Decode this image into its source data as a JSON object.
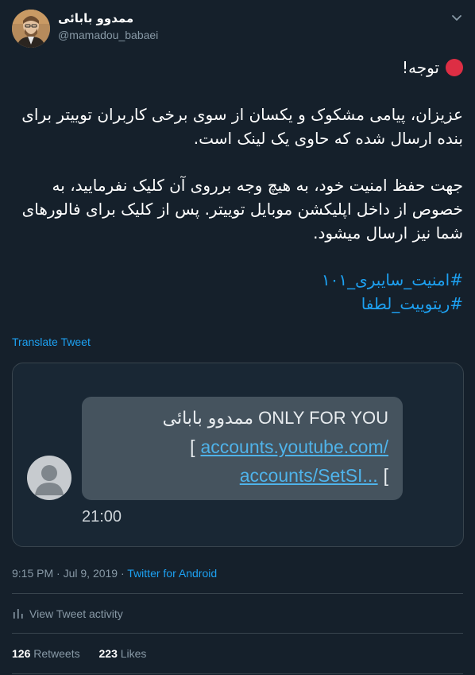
{
  "author": {
    "display_name": "ممدوو بابائی",
    "handle": "@mamadou_babaei"
  },
  "tweet": {
    "line_attention": "توجه!",
    "paragraph1": "عزیزان، پیامی مشکوک و یکسان از سوی برخی کاربران توییتر برای بنده ارسال شده که حاوی یک لینک است.",
    "paragraph2": "جهت حفظ امنیت خود، به هیچ وجه برروی آن کلیک نفرمایید، به خصوص از داخل اپلیکشن موبایل توییتر. پس از کلیک برای فالورهای شما نیز ارسال میشود.",
    "hashtag1": "#امنیت_سایبری_۱۰۱",
    "hashtag2": "#ریتوییت_لطفا",
    "attention_dot_color": "#dd2e44"
  },
  "translate_label": "Translate Tweet",
  "media": {
    "message_prefix": "ONLY FOR YOU",
    "message_name": "ممدوو بابائی",
    "link1": "accounts.youtube.com/",
    "link2": "accounts/SetSI...",
    "time": "21:00",
    "avatar_icon": "person-icon"
  },
  "meta": {
    "time": "9:15 PM",
    "separator": "·",
    "date": "Jul 9, 2019",
    "source": "Twitter for Android"
  },
  "activity_label": "View Tweet activity",
  "stats": {
    "retweets_count": "126",
    "retweets_label": "Retweets",
    "likes_count": "223",
    "likes_label": "Likes"
  },
  "colors": {
    "background": "#15202b",
    "accent": "#1da1f2",
    "muted": "#8899a6",
    "border": "#38444d"
  }
}
